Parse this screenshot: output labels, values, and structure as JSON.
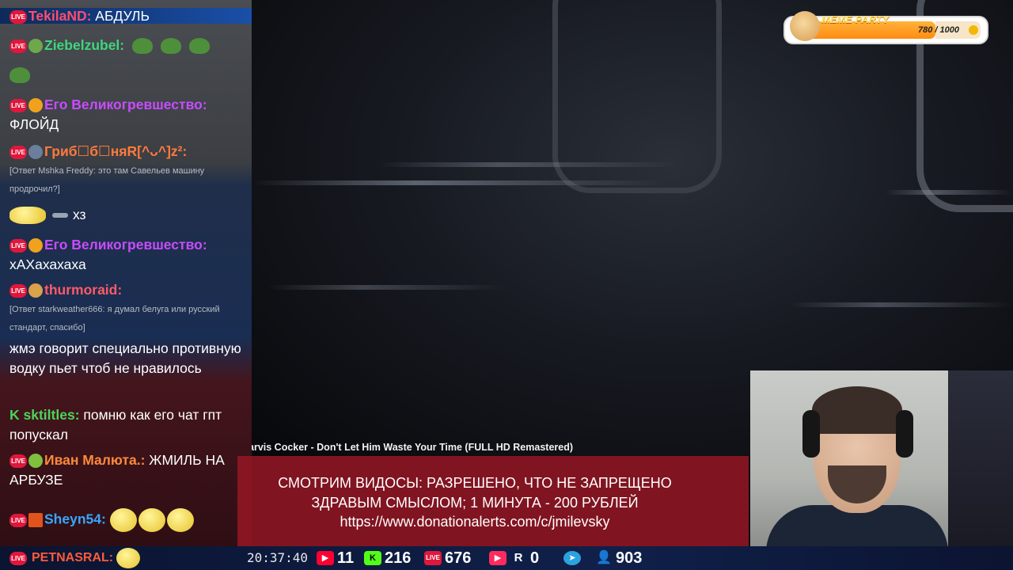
{
  "chat": {
    "messages": [
      {
        "nick": "TekilaND:",
        "text": "АБДУЛЬ",
        "color": "#ff4d6d"
      },
      {
        "nick": "Ziebelzubel:",
        "text": "",
        "color": "#3ed67c"
      },
      {
        "nick": "Его Великогревшество:",
        "text": "ФЛОЙД",
        "color": "#c84cff"
      },
      {
        "nick": "Гриб☐б☐няR[^ᴗ^]z²:",
        "text": "",
        "color": "#ff7a3d",
        "reply": "[Ответ Mshka Freddy: это там Савельев машину продрочил?]"
      },
      {
        "nick": "",
        "text": "хз"
      },
      {
        "nick": "Его Великогревшество:",
        "text": "хАХахахаха",
        "color": "#c84cff"
      },
      {
        "nick": "thurmoraid:",
        "text": "",
        "color": "#ff5a6a",
        "reply": "[Ответ starkweather666: я думал белуга или русский стандарт, спасибо]"
      },
      {
        "nick": "",
        "text": "жмэ говорит специально противную водку пьет чтоб не нравилось"
      },
      {
        "nick": "sktiltles:",
        "text": "помню как его чат гпт попускал",
        "color": "#4bd35e"
      },
      {
        "nick": "Иван Малюта.:",
        "text": "ЖМИЛЬ НА АРБУЗЕ",
        "color": "#ff8a3d"
      },
      {
        "nick": "Sheyn54:",
        "text": "",
        "color": "#38a7ff"
      },
      {
        "nick": "PETNASRAL:",
        "text": "",
        "color": "#ff5a3d"
      }
    ]
  },
  "video": {
    "title": "arvis Cocker - Don't Let Him Waste Your Time (FULL HD Remastered)"
  },
  "banner": {
    "line1": "СМОТРИМ ВИДОСЫ: РАЗРЕШЕНО, ЧТО НЕ ЗАПРЕЩЕНО",
    "line2": "ЗДРАВЫМ СМЫСЛОМ; 1 МИНУТА - 200 РУБЛЕЙ",
    "line3": "https://www.donationalerts.com/c/jmilevsky"
  },
  "meme_party": {
    "title": "MEME PARTY",
    "count": "780 / 1000",
    "progress": 0.78
  },
  "status": {
    "time": "20:37:40",
    "youtube": "11",
    "kick": "216",
    "live": "676",
    "rutube": "0",
    "viewers": "903"
  },
  "live_badge": "LIVE"
}
